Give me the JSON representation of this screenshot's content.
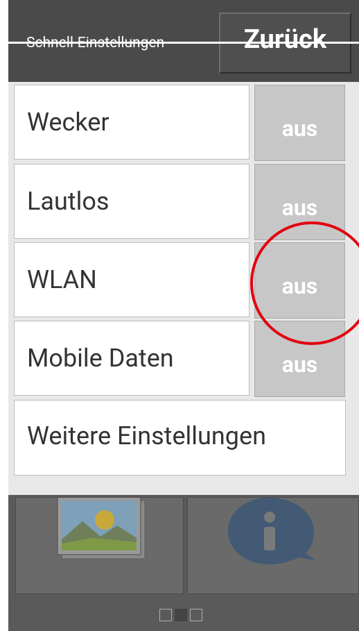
{
  "header": {
    "title": "Schnell-Einstellungen",
    "back_label": "Zurück"
  },
  "menu": {
    "rows": [
      {
        "label": "Wecker",
        "state": "aus"
      },
      {
        "label": "Lautlos",
        "state": "aus"
      },
      {
        "label": "WLAN",
        "state": "aus"
      },
      {
        "label": "Mobile Daten",
        "state": "aus"
      }
    ],
    "more_label": "Weitere Einstellungen"
  },
  "pager": {
    "pages": 3,
    "active": 2
  },
  "colors": {
    "header": "#4a4a4a",
    "toggle": "#c7c7c7",
    "annotation": "#e3000f"
  }
}
